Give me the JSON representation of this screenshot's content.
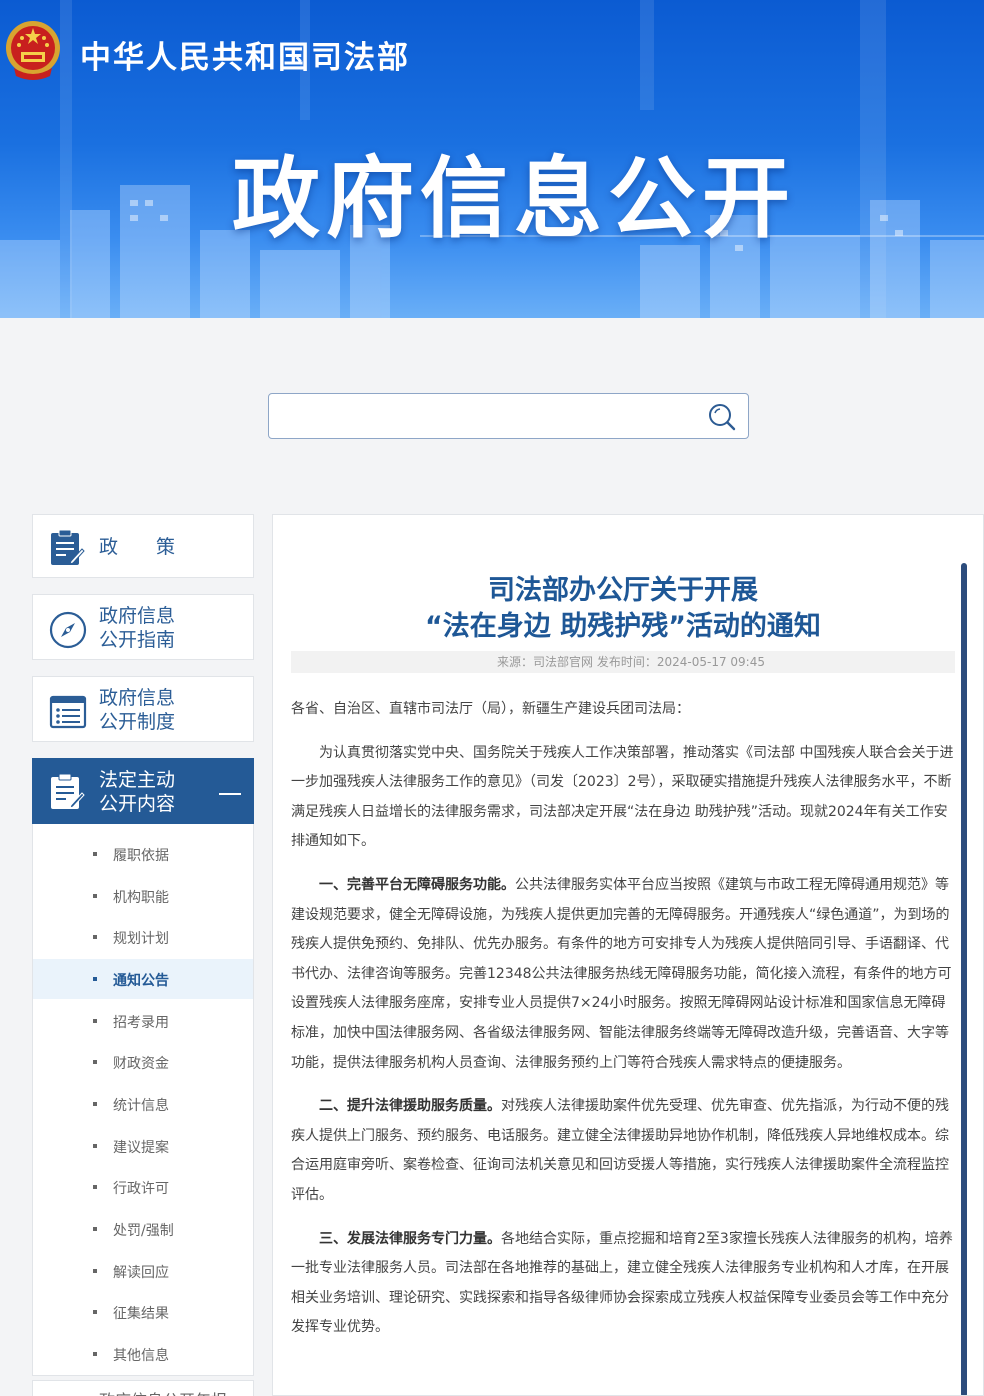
{
  "header": {
    "ministry": "中华人民共和国司法部",
    "title": "政府信息公开"
  },
  "search": {
    "placeholder": ""
  },
  "sidebar": {
    "items": [
      {
        "label_line1": "政　　策",
        "label_line2": ""
      },
      {
        "label_line1": "政府信息",
        "label_line2": "公开指南"
      },
      {
        "label_line1": "政府信息",
        "label_line2": "公开制度"
      },
      {
        "label_line1": "法定主动",
        "label_line2": "公开内容"
      }
    ],
    "subitems": [
      "履职依据",
      "机构职能",
      "规划计划",
      "通知公告",
      "招考录用",
      "财政资金",
      "统计信息",
      "建议提案",
      "行政许可",
      "处罚/强制",
      "解读回应",
      "征集结果",
      "其他信息"
    ],
    "current_subitem": "通知公告",
    "next_item": "政府信息公开年报"
  },
  "article": {
    "title_line1": "司法部办公厅关于开展",
    "title_line2": "“法在身边 助残护残”活动的通知",
    "meta": "来源：司法部官网 发布时间：2024-05-17 09:45",
    "salutation": "各省、自治区、直辖市司法厅（局），新疆生产建设兵团司法局：",
    "intro": "为认真贯彻落实党中央、国务院关于残疾人工作决策部署，推动落实《司法部 中国残疾人联合会关于进一步加强残疾人法律服务工作的意见》（司发〔2023〕2号），采取硬实措施提升残疾人法律服务水平，不断满足残疾人日益增长的法律服务需求，司法部决定开展“法在身边 助残护残”活动。现就2024年有关工作安排通知如下。",
    "sections": [
      {
        "heading": "一、完善平台无障碍服务功能。",
        "text": "公共法律服务实体平台应当按照《建筑与市政工程无障碍通用规范》等建设规范要求，健全无障碍设施，为残疾人提供更加完善的无障碍服务。开通残疾人“绿色通道”，为到场的残疾人提供免预约、免排队、优先办服务。有条件的地方可安排专人为残疾人提供陪同引导、手语翻译、代书代办、法律咨询等服务。完善12348公共法律服务热线无障碍服务功能，简化接入流程，有条件的地方可设置残疾人法律服务座席，安排专业人员提供7×24小时服务。按照无障碍网站设计标准和国家信息无障碍标准，加快中国法律服务网、各省级法律服务网、智能法律服务终端等无障碍改造升级，完善语音、大字等功能，提供法律服务机构人员查询、法律服务预约上门等符合残疾人需求特点的便捷服务。"
      },
      {
        "heading": "二、提升法律援助服务质量。",
        "text": "对残疾人法律援助案件优先受理、优先审查、优先指派，为行动不便的残疾人提供上门服务、预约服务、电话服务。建立健全法律援助异地协作机制，降低残疾人异地维权成本。综合运用庭审旁听、案卷检查、征询司法机关意见和回访受援人等措施，实行残疾人法律援助案件全流程监控评估。"
      },
      {
        "heading": "三、发展法律服务专门力量。",
        "text": "各地结合实际，重点挖掘和培育2至3家擅长残疾人法律服务的机构，培养一批专业法律服务人员。司法部在各地推荐的基础上，建立健全残疾人法律服务专业机构和人才库，在开展相关业务培训、理论研究、实践探索和指导各级律师协会探索成立残疾人权益保障专业委员会等工作中充分发挥专业优势。"
      }
    ]
  },
  "colors": {
    "banner_blue": "#1a70e0",
    "sidebar_active": "#245a96",
    "title_blue": "#1e5796"
  },
  "icons": [
    "national-emblem-icon",
    "search-icon",
    "document-icon",
    "compass-icon",
    "list-icon",
    "minus-icon"
  ]
}
